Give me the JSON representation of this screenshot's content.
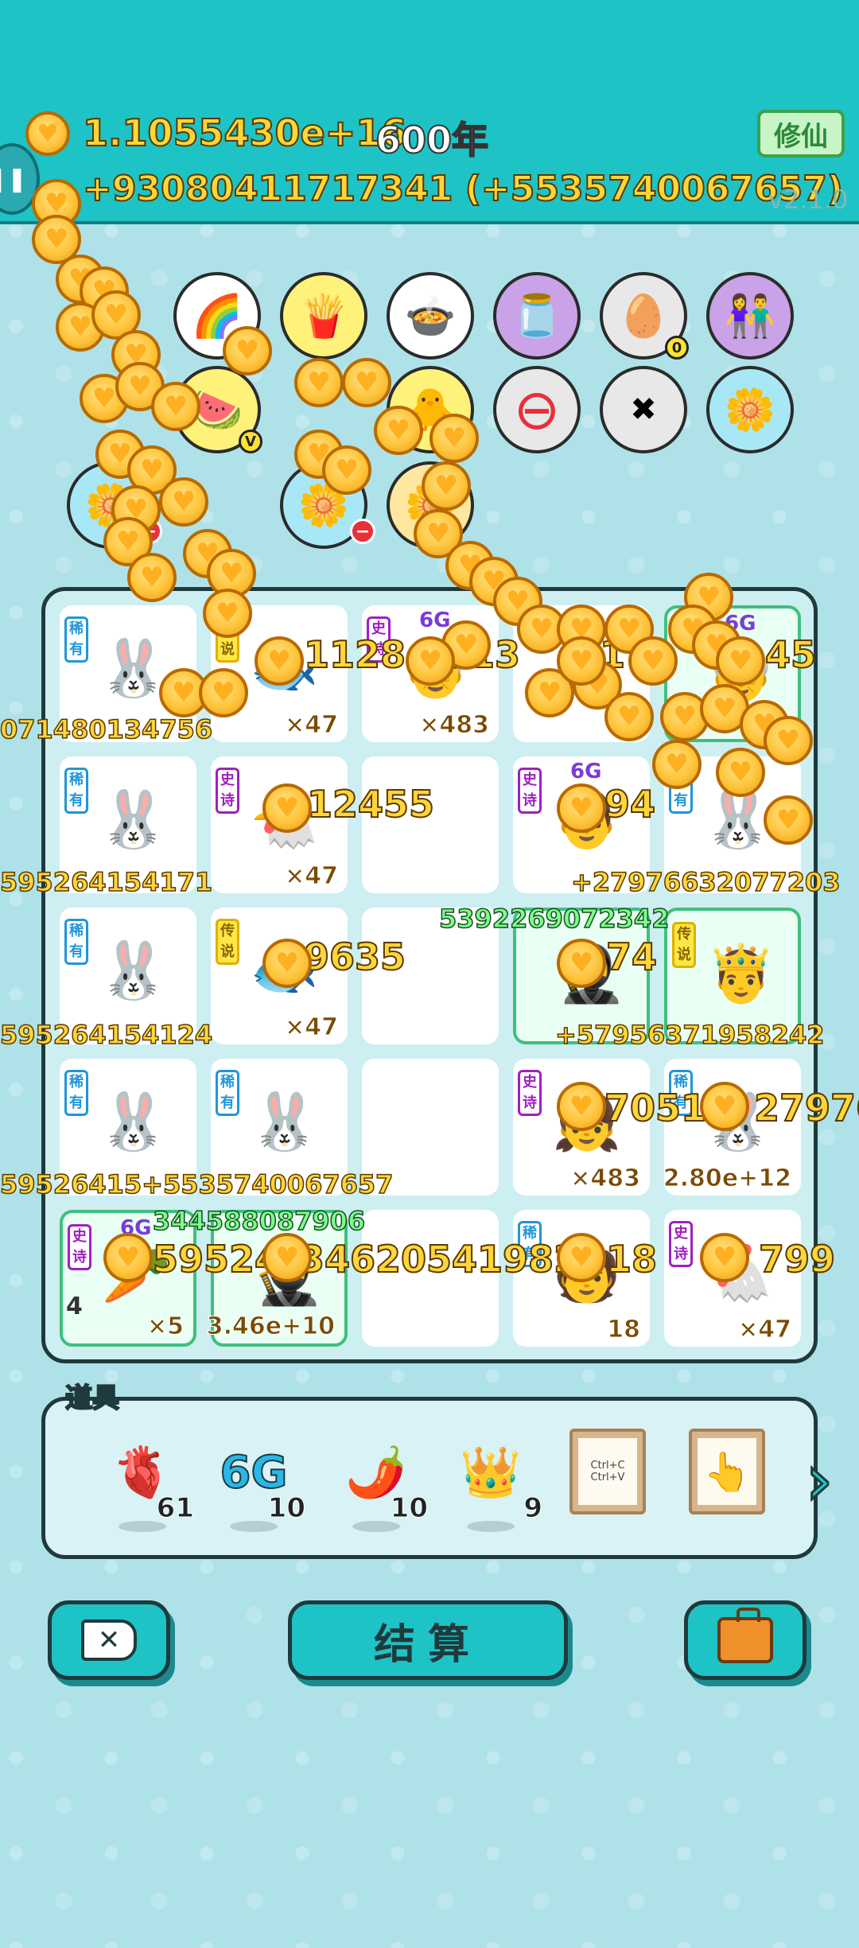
{
  "header": {
    "total": "1.1055430e+16",
    "years": "600年",
    "rate": "+93080411717341 (+5535740067657)",
    "xiuxian_label": "修仙",
    "version": "v2.1.0"
  },
  "skills": [
    {
      "name": "rainbow-skill",
      "icon": "🌈"
    },
    {
      "name": "fries-skill",
      "icon": "🍟"
    },
    {
      "name": "pot-skill",
      "icon": "🍲"
    },
    {
      "name": "jar-skill",
      "icon": "🫙"
    },
    {
      "name": "egg-tray-skill",
      "icon": "🥚",
      "badge": "0"
    },
    {
      "name": "couple-skill",
      "icon": "👫"
    },
    {
      "name": "fruit-skill",
      "icon": "🍉",
      "badge": "V"
    },
    {
      "name": "chick-skill",
      "icon": "🐥"
    },
    {
      "name": "minus-skill",
      "icon": "⊖"
    },
    {
      "name": "delete-skill",
      "icon": "✖"
    },
    {
      "name": "flower-skill",
      "icon": "🌼"
    }
  ],
  "board": {
    "rarity": {
      "common": "稀有",
      "legend": "传说",
      "epic": "史诗"
    },
    "cells": [
      {
        "r": 0,
        "c": 0,
        "rarity": "common",
        "char": "🐰"
      },
      {
        "r": 0,
        "c": 1,
        "rarity": "legend",
        "char": "🐟",
        "count": "×47"
      },
      {
        "r": 0,
        "c": 2,
        "rarity": "epic",
        "char": "👴",
        "count": "×483",
        "six_g": "6G"
      },
      {
        "r": 0,
        "c": 3,
        "rarity": "",
        "char": ""
      },
      {
        "r": 0,
        "c": 4,
        "rarity": "",
        "char": "👴",
        "six_g": "6G",
        "green": true
      },
      {
        "r": 1,
        "c": 0,
        "rarity": "common",
        "char": "🐰"
      },
      {
        "r": 1,
        "c": 1,
        "rarity": "epic",
        "char": "🐔",
        "count": "×47"
      },
      {
        "r": 1,
        "c": 2,
        "rarity": "",
        "char": ""
      },
      {
        "r": 1,
        "c": 3,
        "rarity": "epic",
        "char": "👨",
        "six_g": "6G"
      },
      {
        "r": 1,
        "c": 4,
        "rarity": "common",
        "char": "🐰"
      },
      {
        "r": 2,
        "c": 0,
        "rarity": "common",
        "char": "🐰"
      },
      {
        "r": 2,
        "c": 1,
        "rarity": "legend",
        "char": "🐟",
        "count": "×47"
      },
      {
        "r": 2,
        "c": 2,
        "rarity": "",
        "char": ""
      },
      {
        "r": 2,
        "c": 3,
        "rarity": "",
        "char": "🥷",
        "green": true
      },
      {
        "r": 2,
        "c": 4,
        "rarity": "legend",
        "char": "🤴",
        "green": true
      },
      {
        "r": 3,
        "c": 0,
        "rarity": "common",
        "char": "🐰"
      },
      {
        "r": 3,
        "c": 1,
        "rarity": "common",
        "char": "🐰"
      },
      {
        "r": 3,
        "c": 2,
        "rarity": "",
        "char": ""
      },
      {
        "r": 3,
        "c": 3,
        "rarity": "epic",
        "char": "👧",
        "count": "×483"
      },
      {
        "r": 3,
        "c": 4,
        "rarity": "common",
        "char": "🐰",
        "count": "2.80e+12"
      },
      {
        "r": 4,
        "c": 0,
        "rarity": "epic",
        "char": "🥕",
        "count": "×5",
        "six_g": "6G",
        "green": true,
        "level": "4"
      },
      {
        "r": 4,
        "c": 1,
        "rarity": "",
        "char": "🥷",
        "count": "3.46e+10",
        "green": true
      },
      {
        "r": 4,
        "c": 2,
        "rarity": "",
        "char": ""
      },
      {
        "r": 4,
        "c": 3,
        "rarity": "common",
        "char": "🧑",
        "count": "18"
      },
      {
        "r": 4,
        "c": 4,
        "rarity": "epic",
        "char": "🐔",
        "count": "×47"
      }
    ],
    "floating": [
      {
        "text": "1128",
        "kind": "gold"
      },
      {
        "text": "5313",
        "kind": "gold"
      },
      {
        "text": "1",
        "kind": "gold"
      },
      {
        "text": "45",
        "kind": "gold"
      },
      {
        "text": "071480134756",
        "kind": "small"
      },
      {
        "text": "12455",
        "kind": "gold"
      },
      {
        "text": "94",
        "kind": "gold"
      },
      {
        "text": "595264154171",
        "kind": "small"
      },
      {
        "text": "+27976632077203",
        "kind": "small"
      },
      {
        "text": "5392269072342",
        "kind": "green"
      },
      {
        "text": "9635",
        "kind": "gold"
      },
      {
        "text": "74",
        "kind": "gold"
      },
      {
        "text": "595264154124",
        "kind": "small"
      },
      {
        "text": "+57956371958242",
        "kind": "small"
      },
      {
        "text": "70518",
        "kind": "gold"
      },
      {
        "text": "27976",
        "kind": "gold"
      },
      {
        "text": "59526415+5535740067657",
        "kind": "small"
      },
      {
        "text": "344588087906",
        "kind": "green"
      },
      {
        "text": "59524",
        "kind": "gold"
      },
      {
        "text": "34620541982",
        "kind": "gold"
      },
      {
        "text": "18",
        "kind": "gold"
      },
      {
        "text": "799",
        "kind": "gold"
      }
    ]
  },
  "items": {
    "title": "道具",
    "list": [
      {
        "name": "liver-item",
        "icon": "🫀",
        "count": "61"
      },
      {
        "name": "six-g-item",
        "icon": "6G",
        "count": "10"
      },
      {
        "name": "chili-item",
        "icon": "🌶️",
        "count": "10"
      },
      {
        "name": "crown-item",
        "icon": "👑",
        "count": "9"
      },
      {
        "name": "copy-paste-item",
        "icon": "Ctrl+C\nCtrl+V",
        "count": ""
      },
      {
        "name": "pointer-item",
        "icon": "👆",
        "count": ""
      }
    ]
  },
  "buttons": {
    "settle_label": "结算"
  }
}
